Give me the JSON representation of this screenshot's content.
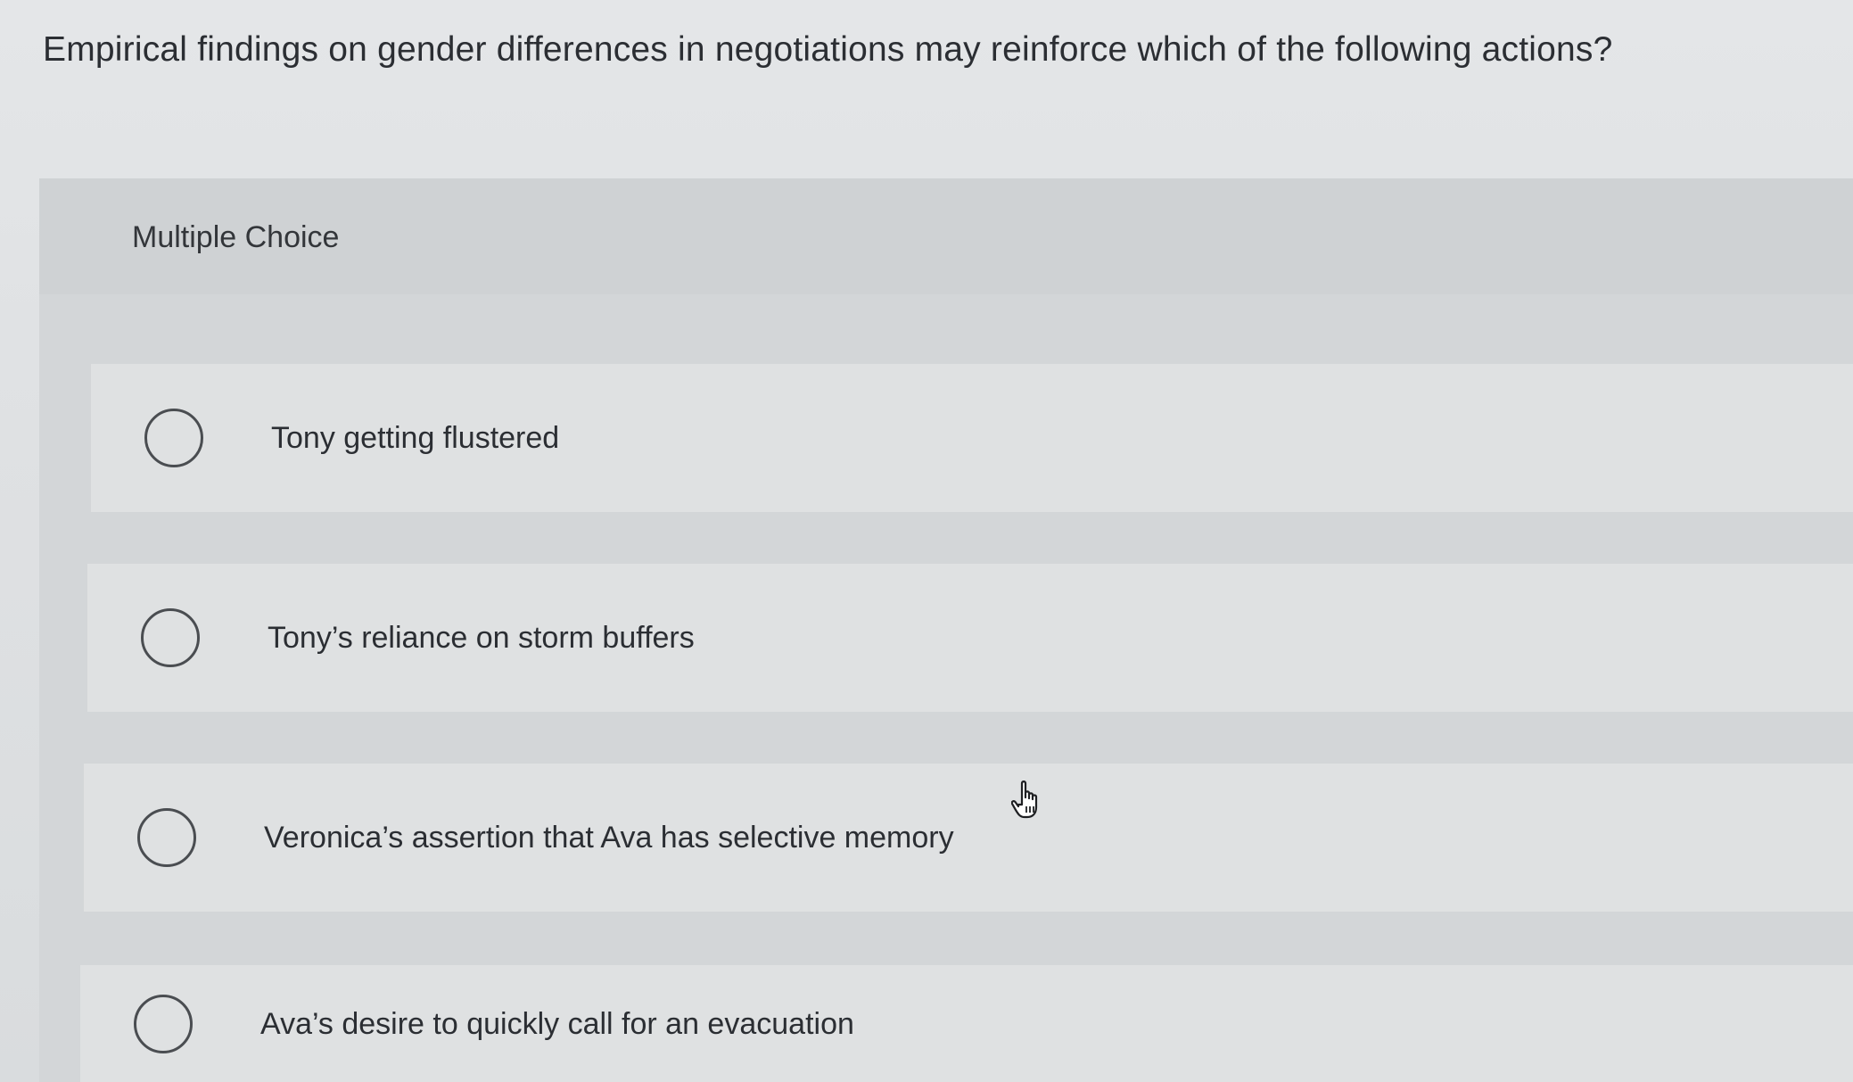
{
  "question": {
    "text": "Empirical findings on gender differences in negotiations may reinforce which of the following actions?"
  },
  "panel": {
    "label": "Multiple Choice"
  },
  "options": [
    {
      "label": "Tony getting flustered",
      "selected": false
    },
    {
      "label": "Tony’s reliance on storm buffers",
      "selected": false
    },
    {
      "label": "Veronica’s assertion that Ava has selective memory",
      "selected": false
    },
    {
      "label": "Ava’s desire to quickly call for an evacuation",
      "selected": false
    }
  ],
  "icons": {
    "radio": "radio-unchecked-icon",
    "cursor": "hand-pointer-icon"
  }
}
